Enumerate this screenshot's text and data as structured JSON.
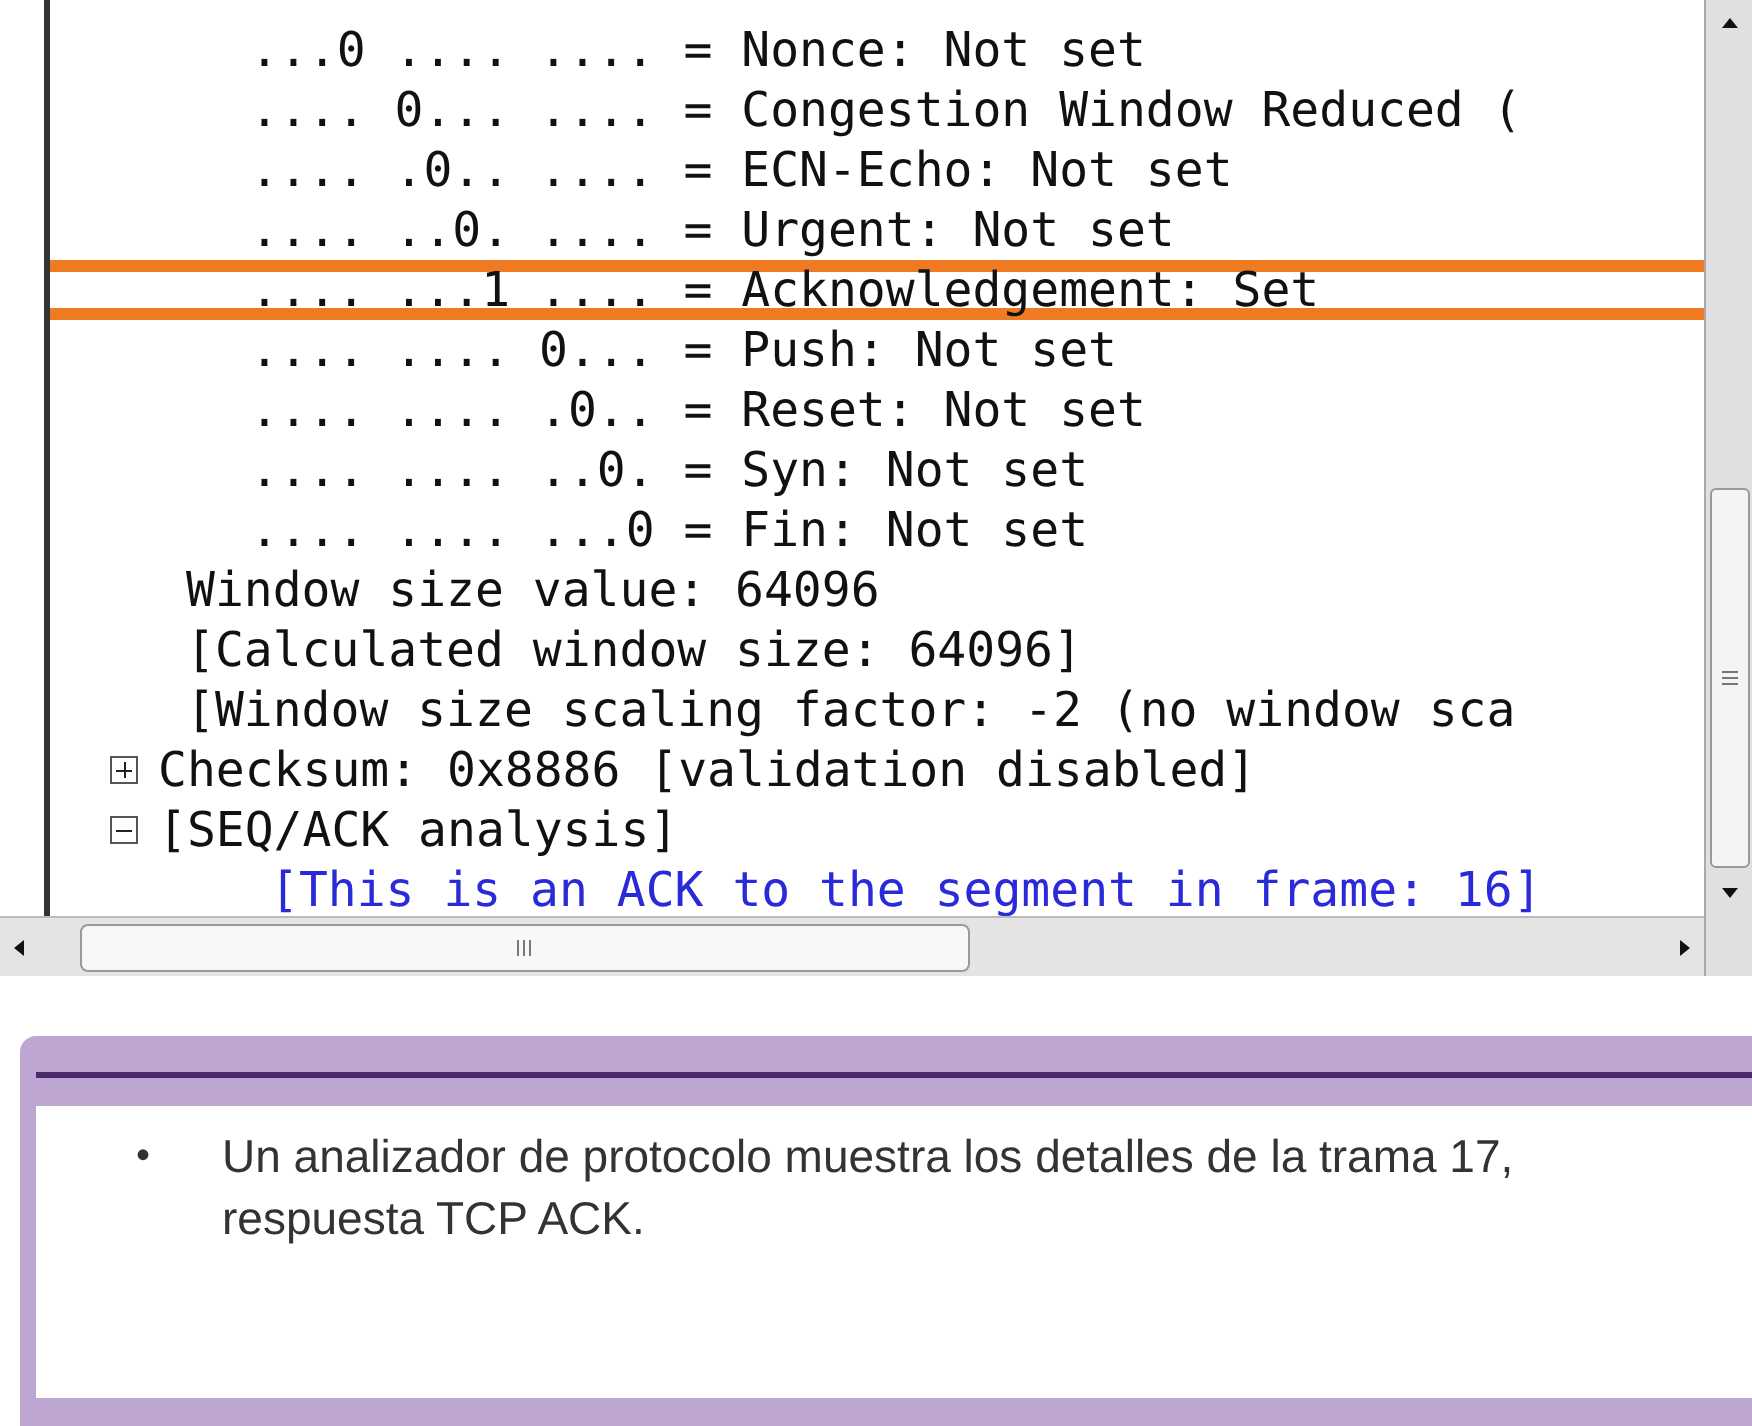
{
  "packet_details": {
    "rows": [
      {
        "kind": "flag",
        "text": "...0 .... .... = Nonce: Not set",
        "highlighted": false
      },
      {
        "kind": "flag",
        "text": ".... 0... .... = Congestion Window Reduced (",
        "highlighted": false
      },
      {
        "kind": "flag",
        "text": ".... .0.. .... = ECN-Echo: Not set",
        "highlighted": false
      },
      {
        "kind": "flag",
        "text": ".... ..0. .... = Urgent: Not set",
        "highlighted": false
      },
      {
        "kind": "flag",
        "text": ".... ...1 .... = Acknowledgement: Set",
        "highlighted": true
      },
      {
        "kind": "flag",
        "text": ".... .... 0... = Push: Not set",
        "highlighted": false
      },
      {
        "kind": "flag",
        "text": ".... .... .0.. = Reset: Not set",
        "highlighted": false
      },
      {
        "kind": "flag",
        "text": ".... .... ..0. = Syn: Not set",
        "highlighted": false
      },
      {
        "kind": "flag",
        "text": ".... .... ...0 = Fin: Not set",
        "highlighted": false
      },
      {
        "kind": "field",
        "text": "Window size value: 64096",
        "highlighted": false
      },
      {
        "kind": "field",
        "text": "[Calculated window size: 64096]",
        "highlighted": false
      },
      {
        "kind": "field",
        "text": "[Window size scaling factor: -2 (no window sca",
        "highlighted": false
      },
      {
        "kind": "node",
        "text": "Checksum: 0x8886 [validation disabled]",
        "expanded": false,
        "highlighted": false
      },
      {
        "kind": "node",
        "text": "[SEQ/ACK analysis]",
        "expanded": true,
        "highlighted": false,
        "children": [
          {
            "kind": "link",
            "text": "[This is an ACK to the segment in frame: 16]",
            "highlighted": false
          }
        ]
      }
    ]
  },
  "caption": {
    "bullet": "•",
    "text": "Un analizador de protocolo muestra los detalles de la trama 17, respuesta TCP ACK."
  }
}
